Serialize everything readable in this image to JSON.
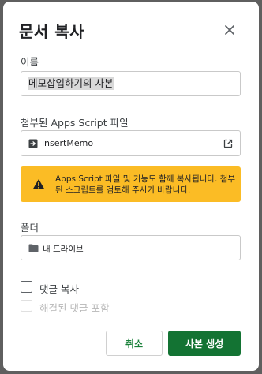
{
  "dialog": {
    "title": "문서 복사",
    "close_icon": "close-icon"
  },
  "name": {
    "label": "이름",
    "value": "메모삽입하기의 사본"
  },
  "script": {
    "label": "첨부된 Apps Script 파일",
    "file_name": "insertMemo",
    "file_icon": "apps-script-icon",
    "open_icon": "open-in-new-icon"
  },
  "warning": {
    "text": "Apps Script 파일 및 기능도 함께 복사됩니다. 첨부된 스크립트를 검토해 주시기 바랍니다.",
    "icon": "warning-icon",
    "color": "#fbbc25"
  },
  "folder": {
    "label": "폴더",
    "value": "내 드라이브",
    "icon": "folder-icon"
  },
  "options": {
    "copy_comments": {
      "label": "댓글 복사",
      "checked": false
    },
    "resolved_comments": {
      "label": "해결된 댓글 포함",
      "checked": false,
      "disabled": true
    }
  },
  "buttons": {
    "cancel": "취소",
    "submit": "사본 생성"
  },
  "colors": {
    "primary": "#137333",
    "cancel_text": "#188038"
  }
}
